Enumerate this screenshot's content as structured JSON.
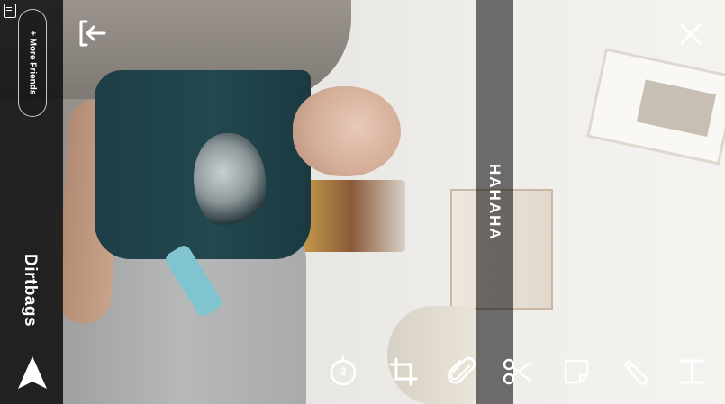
{
  "top_left": {
    "icon": "message-list-icon"
  },
  "friends_button": {
    "label": "+ More Friends"
  },
  "recipient": {
    "name": "Dirtbags"
  },
  "caption": {
    "text": "HAHAHA"
  },
  "toolbar": {
    "timer": {
      "icon": "timer-icon",
      "value": "3"
    },
    "crop": {
      "icon": "crop-icon"
    },
    "attach": {
      "icon": "paperclip-icon"
    },
    "scissors": {
      "icon": "scissors-icon"
    },
    "sticker": {
      "icon": "sticker-icon"
    },
    "pencil": {
      "icon": "pencil-icon"
    },
    "text": {
      "icon": "text-tool-icon"
    }
  },
  "exit": {
    "icon": "exit-arrow-icon"
  },
  "close": {
    "icon": "close-icon"
  },
  "send": {
    "icon": "send-icon"
  }
}
